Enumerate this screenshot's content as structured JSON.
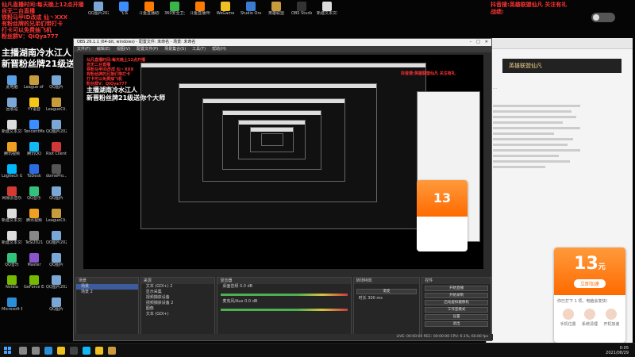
{
  "overlay": {
    "red_lines": [
      "仙凡直播时间:每天晚上12点开播",
      "自无二台直播",
      "铁粉马甲ID改成 仙丶XXX",
      "有粉丝牌的兄弟们带打卡",
      "打卡可以免费抽飞机",
      "粉丝群V：QiQya777"
    ],
    "title_line1": "主播湖南冷水江人",
    "title_line2": "新晋粉丝牌21级送你个大师",
    "right_line1": "抖音搜:英雄联盟仙凡 关注有礼",
    "right_line2": "战绩:"
  },
  "desktop_icons": {
    "top": [
      {
        "label": "QQ图片20210828...",
        "color": "#7aa7d6"
      },
      {
        "label": "飞书",
        "color": "#3c8dff"
      },
      {
        "label": "斗鱼直播助手",
        "color": "#ff7a00"
      },
      {
        "label": "360安全卫士",
        "color": "#39b54a"
      },
      {
        "label": "斗鱼直播伴侣",
        "color": "#ff7a00"
      },
      {
        "label": "WeGame",
        "color": "#f0c020"
      },
      {
        "label": "Studio One",
        "color": "#3b7bd1"
      },
      {
        "label": "英雄联盟",
        "color": "#c89b3c"
      },
      {
        "label": "OBS Studio",
        "color": "#333333"
      },
      {
        "label": "新建文本文档",
        "color": "#dddddd"
      }
    ],
    "col1": [
      {
        "label": "此电脑",
        "color": "#5aa0e6"
      },
      {
        "label": "回收站",
        "color": "#7aa7d6"
      },
      {
        "label": "新建文本文档",
        "color": "#dddddd"
      },
      {
        "label": "腾讯视频",
        "color": "#f0a020"
      },
      {
        "label": "Logitech G HUB",
        "color": "#00b8fc"
      },
      {
        "label": "网易云音乐",
        "color": "#d33a31"
      },
      {
        "label": "新建文本文档",
        "color": "#dddddd"
      },
      {
        "label": "新建文本文档",
        "color": "#dddddd"
      },
      {
        "label": "QQ音乐",
        "color": "#31c27c"
      },
      {
        "label": "Nvidia",
        "color": "#76b900"
      },
      {
        "label": "Microsoft Edge",
        "color": "#2a8fd8"
      }
    ],
    "col2": [
      {
        "label": "League of Legends",
        "color": "#c89b3c"
      },
      {
        "label": "YY语音",
        "color": "#f5c518"
      },
      {
        "label": "TencentMe...",
        "color": "#3c8dff"
      },
      {
        "label": "腾讯QQ",
        "color": "#12b7f5"
      },
      {
        "label": "ToDesk",
        "color": "#2b6de0"
      },
      {
        "label": "QQ音乐",
        "color": "#31c27c"
      },
      {
        "label": "腾讯视频",
        "color": "#f0a020"
      },
      {
        "label": "TeSi2021",
        "color": "#888888"
      },
      {
        "label": "Master",
        "color": "#8855cc"
      },
      {
        "label": "GeForce Experience",
        "color": "#76b900"
      }
    ],
    "col3": [
      {
        "label": "QQ图片",
        "color": "#7aa7d6"
      },
      {
        "label": "LeagueCli...",
        "color": "#c89b3c"
      },
      {
        "label": "QQ图片2021",
        "color": "#7aa7d6"
      },
      {
        "label": "Riot Client",
        "color": "#d13639"
      },
      {
        "label": "domePro...",
        "color": "#555555"
      },
      {
        "label": "QQ图片",
        "color": "#7aa7d6"
      },
      {
        "label": "LeagueCli...",
        "color": "#c89b3c"
      },
      {
        "label": "QQ图片2021",
        "color": "#7aa7d6"
      },
      {
        "label": "QQ图片",
        "color": "#7aa7d6"
      },
      {
        "label": "QQ图片2021",
        "color": "#7aa7d6"
      },
      {
        "label": "QQ图片",
        "color": "#7aa7d6"
      }
    ]
  },
  "obs": {
    "window_title": "OBS 26.1.1 (64-bit, windows) - 配置文件: 未命名 - 场景: 未命名",
    "menu": [
      "文件(F)",
      "编辑(E)",
      "视图(V)",
      "配置文件(P)",
      "场景集合(S)",
      "工具(T)",
      "帮助(H)"
    ],
    "docks": {
      "scenes": {
        "title": "场景",
        "items": [
          "场景",
          "场景 2"
        ]
      },
      "sources": {
        "title": "来源",
        "items": [
          "文本 (GDI+) 2",
          "显示采集",
          "视频捕获设备",
          "视频捕获设备 2",
          "图像",
          "文本 (GDI+)"
        ]
      },
      "mixer": {
        "title": "混音器",
        "channels": [
          {
            "name": "桌面音频",
            "level": "0.0 dB"
          },
          {
            "name": "麦克风/Aux",
            "level": "0.0 dB"
          }
        ]
      },
      "transitions": {
        "title": "转场特效",
        "type": "渐变",
        "duration_label": "时长",
        "duration": "300 ms"
      },
      "controls": {
        "title": "控件",
        "buttons": [
          "开始直播",
          "开始录制",
          "启动虚拟摄像机",
          "工作室模式",
          "设置",
          "退出"
        ]
      }
    },
    "status": "LIVE: 00:00:00   REC: 00:00:00   CPU: 6.1%, 60.00 fps"
  },
  "browser": {
    "banner": "英雄联盟仙凡",
    "text_block": "…"
  },
  "cs_card": {
    "number": "13",
    "unit": "元",
    "button": "立即加速",
    "caption": "你已打下 1 项，电脑会变快！",
    "options": [
      "手机位置",
      "系统清理",
      "开机加速"
    ]
  },
  "taskbar": {
    "time": "0:05",
    "date": "2021/08/29",
    "icons": [
      {
        "name": "search",
        "color": "#888888"
      },
      {
        "name": "task-view",
        "color": "#888888"
      },
      {
        "name": "edge",
        "color": "#2a8fd8"
      },
      {
        "name": "explorer",
        "color": "#f0c020"
      },
      {
        "name": "obs",
        "color": "#444444"
      },
      {
        "name": "qq",
        "color": "#12b7f5"
      },
      {
        "name": "wegame",
        "color": "#f0c020"
      },
      {
        "name": "league",
        "color": "#c89b3c"
      }
    ]
  }
}
